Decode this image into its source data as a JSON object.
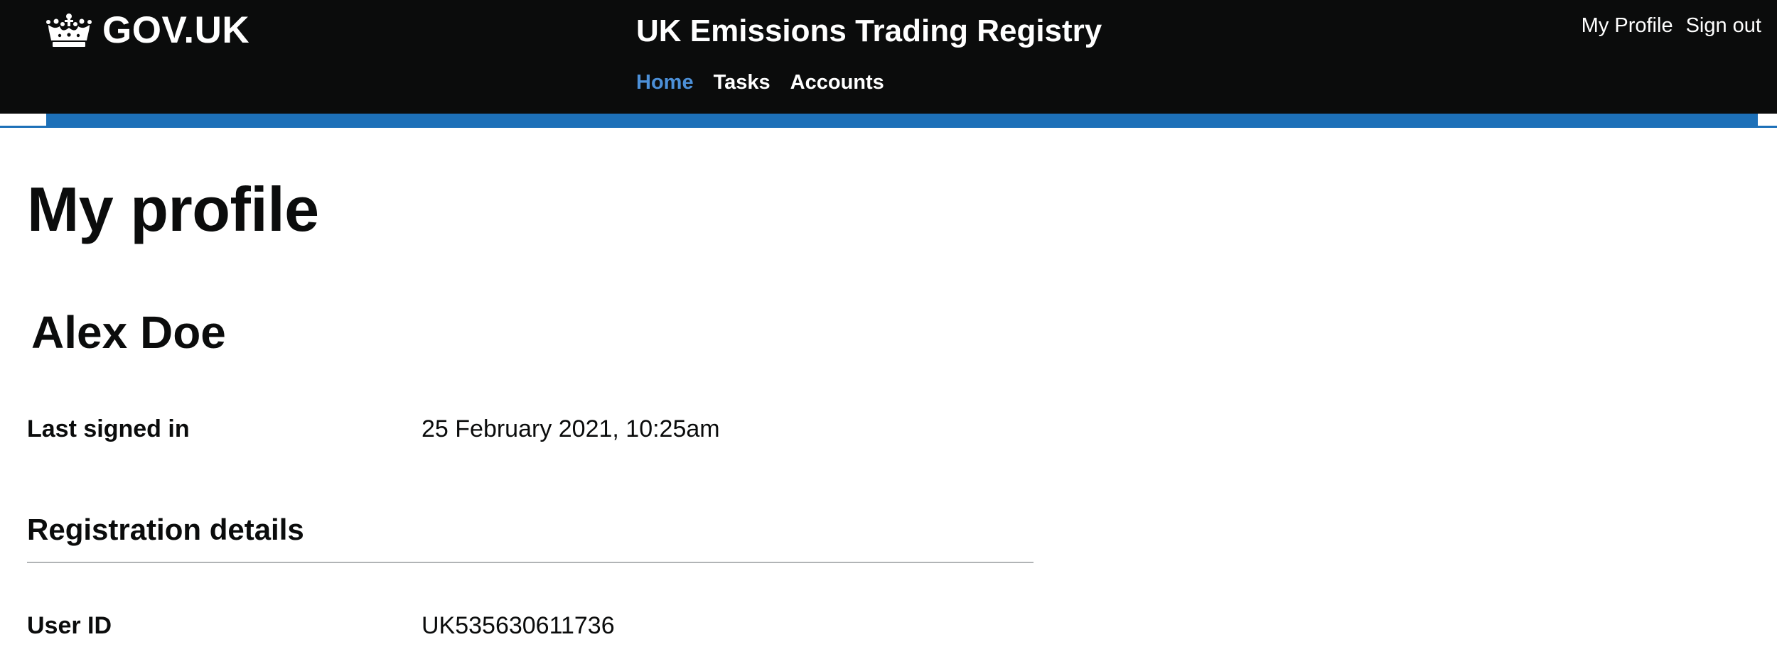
{
  "header": {
    "logo_text": "GOV.UK",
    "service_name": "UK Emissions Trading Registry",
    "nav": [
      {
        "label": "Home",
        "active": true
      },
      {
        "label": "Tasks",
        "active": false
      },
      {
        "label": "Accounts",
        "active": false
      }
    ],
    "account_links": {
      "my_profile": "My Profile",
      "sign_out": "Sign out"
    }
  },
  "main": {
    "page_title": "My profile",
    "user_name": "Alex Doe",
    "last_signed_in": {
      "label": "Last signed in",
      "value": "25 February 2021, 10:25am"
    },
    "registration_details": {
      "heading": "Registration details",
      "user_id": {
        "label": "User ID",
        "value": "UK535630611736"
      }
    }
  },
  "colors": {
    "header_bg": "#0b0c0c",
    "brand_blue": "#1d70b8",
    "active_nav": "#4c90d8",
    "text": "#0b0c0c",
    "rule": "#b1b4b6"
  },
  "icons": {
    "logo": "crown-icon"
  }
}
